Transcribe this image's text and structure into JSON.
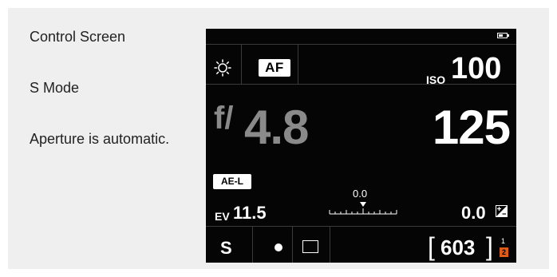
{
  "captions": {
    "line1": "Control Screen",
    "line2": "S Mode",
    "line3": "Aperture is automatic."
  },
  "screen": {
    "battery_icon": "battery-icon",
    "white_balance_icon": "sun-icon",
    "focus_mode": "AF",
    "iso_label": "ISO",
    "iso_value": "100",
    "fstop_prefix": "f/",
    "fstop_value": "4.8",
    "shutter_value": "125",
    "ael_label": "AE-L",
    "ev_label": "EV",
    "ev_value": "11.5",
    "meter_value": "0.0",
    "exposure_comp_value": "0.0",
    "exposure_comp_icon": "exposure-compensation-icon",
    "mode": "S",
    "metering_icon": "spot-metering-icon",
    "drive_icon": "single-shot-icon",
    "shots_remaining": "603",
    "card_slot_1": "1",
    "card_slot_2": "2"
  },
  "colors": {
    "screen_bg": "#050505",
    "inactive_value": "#8a8a8a",
    "card_active": "#e05a1a"
  }
}
